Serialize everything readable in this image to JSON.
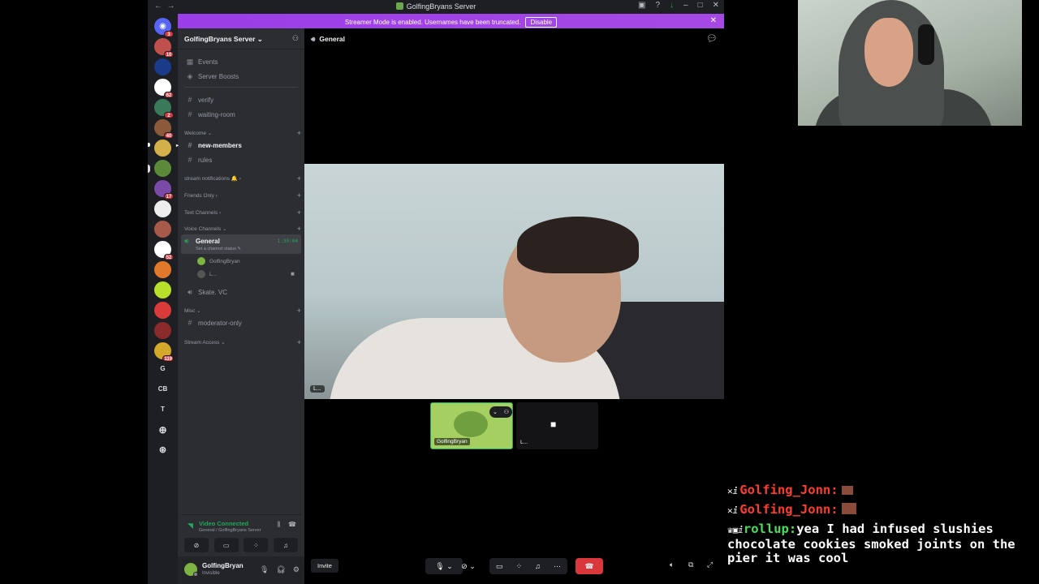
{
  "titlebar": {
    "title": "GolfingBryans Server",
    "back": "←",
    "forward": "→"
  },
  "streamer_banner": {
    "message": "Streamer Mode is enabled. Usernames have been truncated.",
    "disable_label": "Disable",
    "close": "✕"
  },
  "rail": {
    "home_badge": "3",
    "servers": [
      {
        "badge": "10",
        "color": "#c0504d"
      },
      {
        "badge": "",
        "color": "#1a3a8a"
      },
      {
        "badge": "62",
        "color": "#ffffff"
      },
      {
        "badge": "2",
        "color": "#3a7a5a"
      },
      {
        "badge": "40",
        "color": "#8a5a3a"
      },
      {
        "badge": "",
        "color": "#d4b04a"
      },
      {
        "badge": "",
        "color": "#5a8a3a"
      },
      {
        "badge": "17",
        "color": "#7a4aa8"
      },
      {
        "badge": "",
        "color": "#eeeeee"
      },
      {
        "badge": "",
        "color": "#a85a4a"
      },
      {
        "badge": "52",
        "color": "#ffffff"
      },
      {
        "badge": "",
        "color": "#e07a2a"
      },
      {
        "badge": "",
        "color": "#b8e02a"
      },
      {
        "badge": "",
        "color": "#d93a3a"
      },
      {
        "badge": "",
        "color": "#8a2a2a"
      },
      {
        "badge": "119",
        "color": "#d4a82a"
      }
    ],
    "text_servers": [
      "G",
      "CB",
      "T"
    ]
  },
  "sidebar": {
    "server_name": "GolfingBryans Server",
    "chev": "⌄",
    "top_items": [
      {
        "icon": "calendar-icon",
        "glyph": "▦",
        "label": "Events"
      },
      {
        "icon": "boost-icon",
        "glyph": "◈",
        "label": "Server Boosts"
      }
    ],
    "channels_top": [
      "verify",
      "waiting-room"
    ],
    "cat_welcome": "Welcome",
    "channel_new_members": "new-members",
    "channel_rules": "rules",
    "cat_stream": "stream notifications 🔔",
    "cat_friends": "Friends Only",
    "cat_text": "Text Channels",
    "cat_voice": "Voice Channels",
    "voice_general": {
      "name": "General",
      "time": "1:30:04",
      "status": "Set a channel status ✎"
    },
    "voice_users": [
      {
        "name": "GolfingBryan",
        "color": "#7cb342"
      },
      {
        "name": "L...",
        "color": "#555555"
      }
    ],
    "voice_skate": "Skate. VC",
    "cat_misc": "Misc",
    "channel_moderator": "moderator-only",
    "cat_stream_access": "Stream Access",
    "hash": "#",
    "plus": "+"
  },
  "voice_panel": {
    "status": "Video Connected",
    "sub": "General / GolfingBryans Server"
  },
  "user_panel": {
    "name": "GolfingBryan",
    "status": "Invisible"
  },
  "call": {
    "channel": "General",
    "main_tag": "L...",
    "tile1_label": "GolfingBryan",
    "tile2_label": "L...",
    "invite_label": "Invite"
  },
  "overlay": {
    "lines": [
      {
        "user": "Golfing_Jonn:"
      },
      {
        "user": "Golfing_Jonn:"
      }
    ],
    "msg_user": "rollup:",
    "msg_text": "yea I had infused slushies chocolate cookies smoked joints on the pier it was cool"
  },
  "colors": {
    "accent": "#a34be6",
    "connected": "#23a55a",
    "hangup": "#da373c",
    "bg": "#1e1f22"
  }
}
